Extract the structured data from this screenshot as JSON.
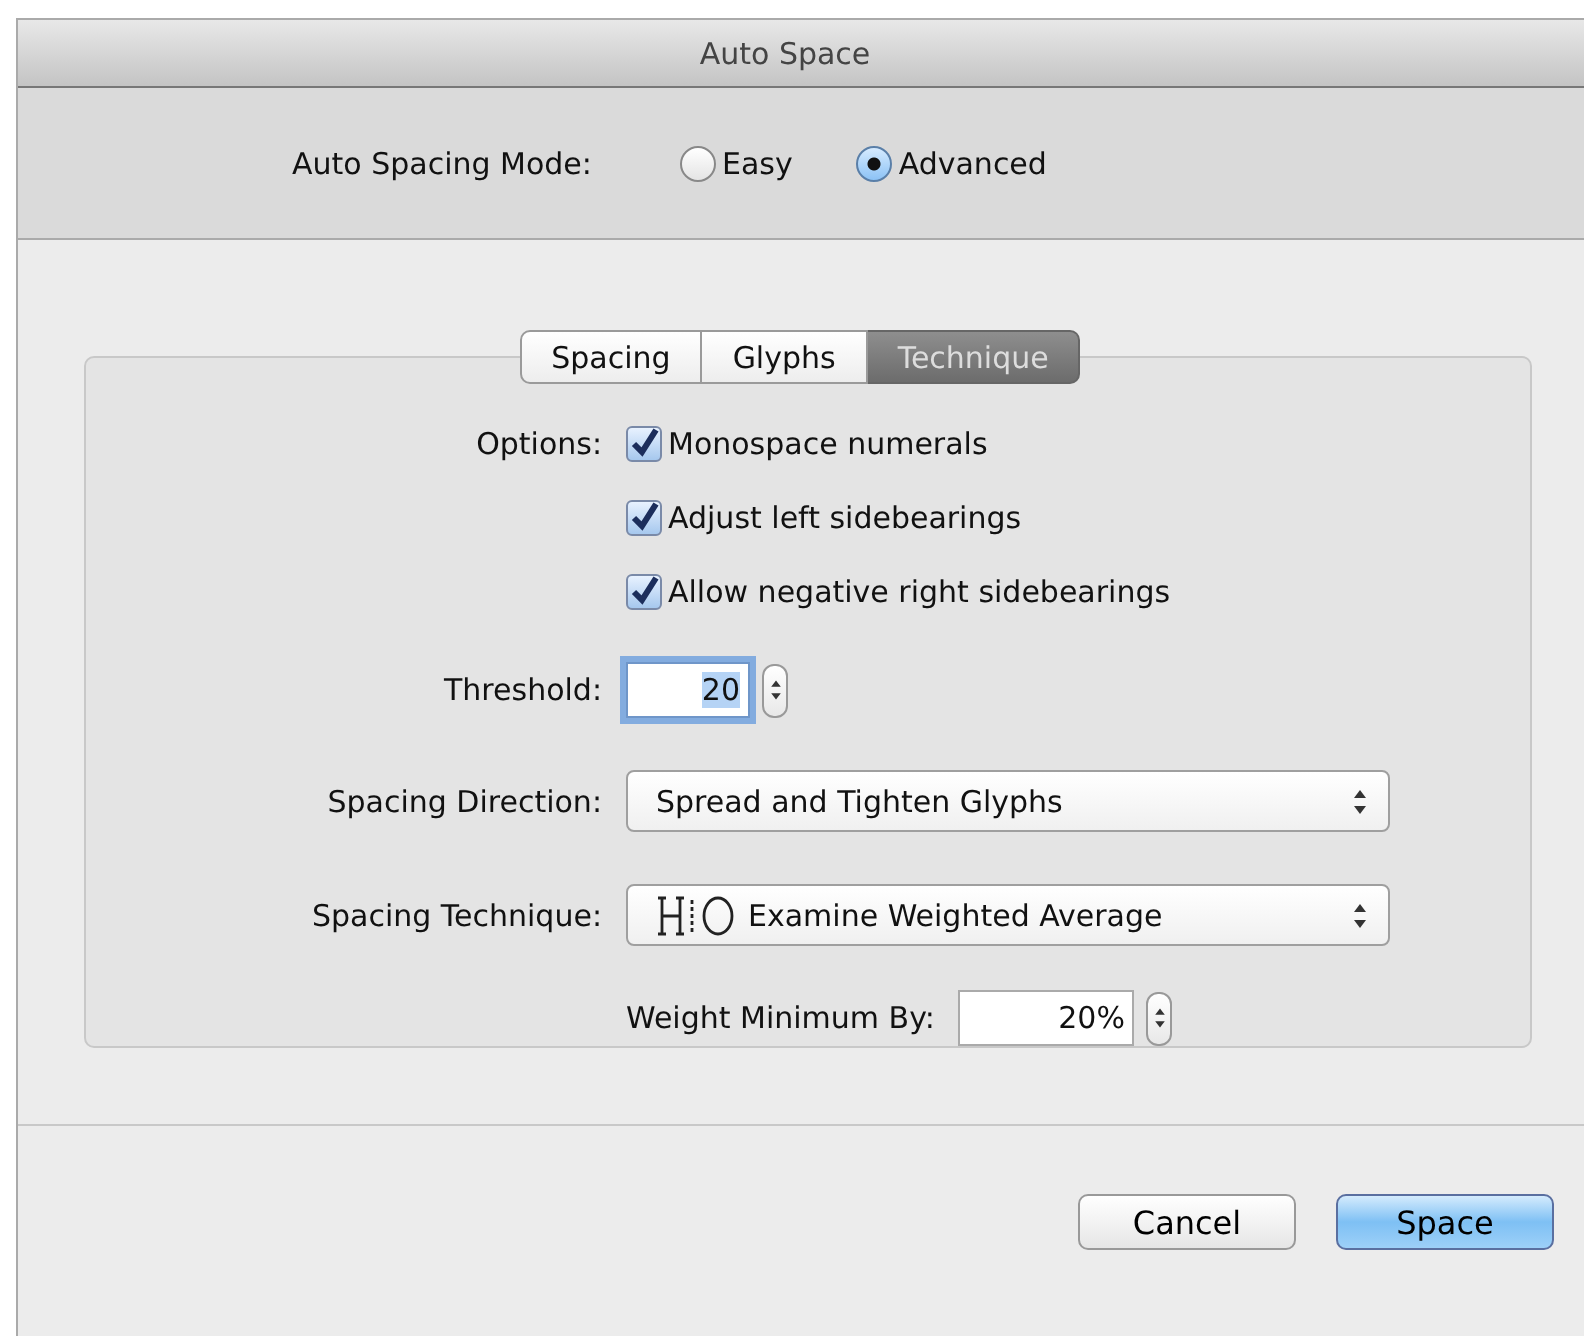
{
  "window": {
    "title": "Auto Space"
  },
  "mode": {
    "label": "Auto Spacing Mode:",
    "options": [
      {
        "label": "Easy",
        "selected": false
      },
      {
        "label": "Advanced",
        "selected": true
      }
    ]
  },
  "tabs": [
    {
      "label": "Spacing",
      "selected": false
    },
    {
      "label": "Glyphs",
      "selected": false
    },
    {
      "label": "Technique",
      "selected": true
    }
  ],
  "options": {
    "label": "Options:",
    "items": [
      {
        "label": "Monospace numerals",
        "checked": true
      },
      {
        "label": "Adjust left sidebearings",
        "checked": true
      },
      {
        "label": "Allow negative right sidebearings",
        "checked": true
      }
    ]
  },
  "threshold": {
    "label": "Threshold:",
    "value": "20",
    "focused": true
  },
  "direction": {
    "label": "Spacing Direction:",
    "value": "Spread and Tighten Glyphs"
  },
  "technique": {
    "label": "Spacing Technique:",
    "value": "Examine Weighted Average"
  },
  "weight": {
    "label": "Weight Minimum By:",
    "value": "20%"
  },
  "buttons": [
    {
      "label": "Cancel",
      "default": false
    },
    {
      "label": "Space",
      "default": true
    }
  ]
}
